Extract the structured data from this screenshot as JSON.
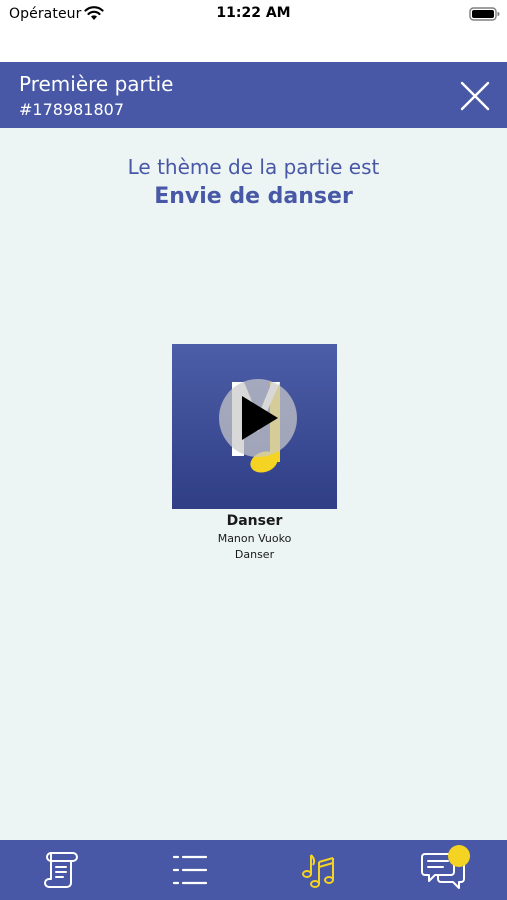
{
  "status_bar": {
    "carrier": "Opérateur",
    "time": "11:22 AM"
  },
  "header": {
    "title": "Première partie",
    "subtitle": "#178981807"
  },
  "theme": {
    "intro": "Le thème de la partie est",
    "name": "Envie de danser"
  },
  "song": {
    "title": "Danser",
    "artist": "Manon Vuoko",
    "album": "Danser"
  },
  "tabs": [
    {
      "icon": "scroll-icon",
      "active": false
    },
    {
      "icon": "list-icon",
      "active": false
    },
    {
      "icon": "music-notes-icon",
      "active": true
    },
    {
      "icon": "chat-icon",
      "active": false,
      "badge": true
    }
  ],
  "colors": {
    "primary": "#4858a6",
    "background": "#ecf4f4",
    "accent": "#f5d322",
    "tab_icon": "#ffffff"
  }
}
